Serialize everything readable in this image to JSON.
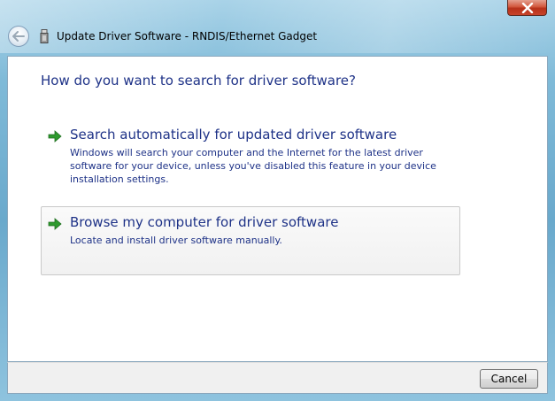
{
  "window": {
    "title": "Update Driver Software - RNDIS/Ethernet Gadget",
    "close_icon": "close-icon",
    "back_icon": "back-arrow-icon",
    "device_icon": "usb-device-icon"
  },
  "content": {
    "heading": "How do you want to search for driver software?",
    "options": [
      {
        "title": "Search automatically for updated driver software",
        "description": "Windows will search your computer and the Internet for the latest driver software for your device, unless you've disabled this feature in your device installation settings.",
        "icon": "green-arrow-icon"
      },
      {
        "title": "Browse my computer for driver software",
        "description": "Locate and install driver software manually.",
        "icon": "green-arrow-icon"
      }
    ]
  },
  "footer": {
    "cancel_label": "Cancel"
  },
  "colors": {
    "link_text": "#1e3287",
    "arrow": "#2e9a2e",
    "close_button": "#c7432a"
  }
}
